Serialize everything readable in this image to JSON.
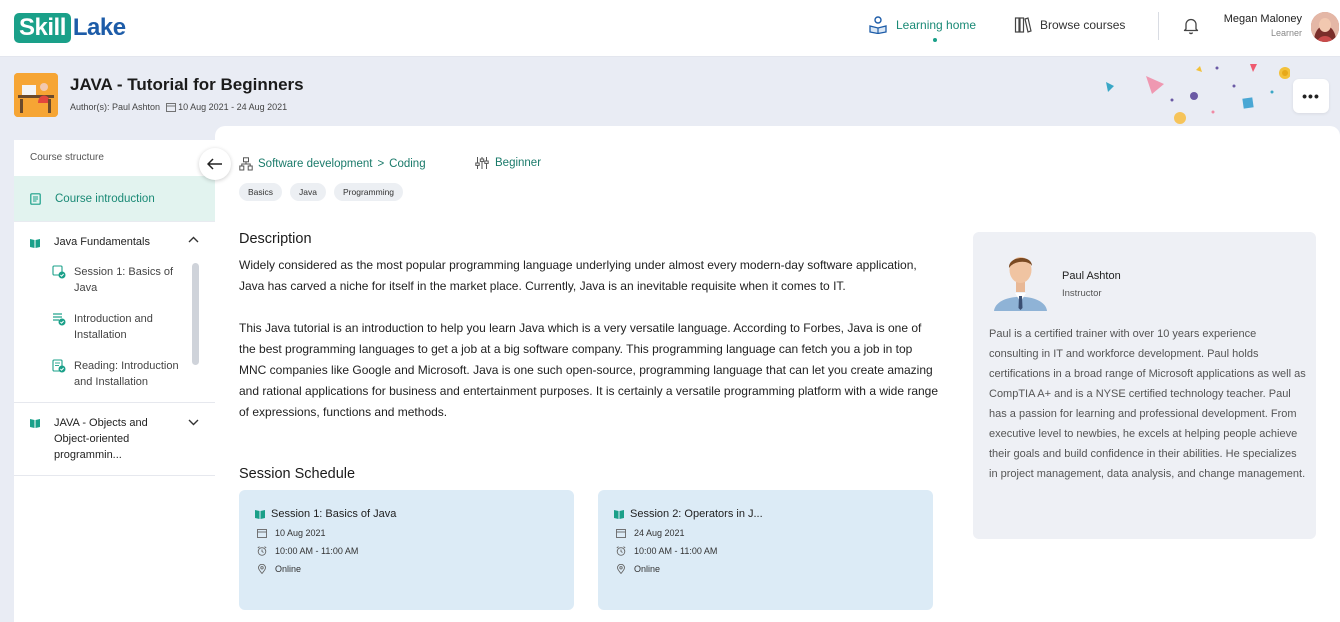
{
  "brand": {
    "logo_part1": "Skill",
    "logo_part2": "Lake",
    "primary_color": "#1aa089",
    "secondary_color": "#1d5ca8"
  },
  "nav": {
    "learning_home": "Learning home",
    "browse_courses": "Browse courses",
    "user_name": "Megan Maloney",
    "user_role": "Learner"
  },
  "course": {
    "title": "JAVA - Tutorial for Beginners",
    "authors": "Author(s): Paul Ashton",
    "dates": "10 Aug 2021 - 24 Aug 2021",
    "more_label": "•••"
  },
  "sidebar": {
    "heading": "Course structure",
    "intro": "Course introduction",
    "modules": [
      {
        "title": "Java Fundamentals",
        "sessions": [
          "Session 1: Basics of Java",
          "Introduction and Installation",
          "Reading: Introduction and Installation"
        ]
      },
      {
        "title": "JAVA - Objects and Object-oriented programmin..."
      }
    ]
  },
  "main": {
    "category": "Software development",
    "subcategory": "Coding",
    "level": "Beginner",
    "tags": [
      "Basics",
      "Java",
      "Programming"
    ],
    "description_heading": "Description",
    "description": [
      "Widely considered as the most popular programming language underlying under almost every modern-day software application, Java has carved a niche for itself in the market place. Currently, Java is an inevitable requisite when it comes to IT.",
      "This Java tutorial is an introduction to help you learn Java which is a very versatile language. According to Forbes, Java is one of the best programming languages to get a job at a big software company. This programming language can fetch you a job in top MNC companies like Google and Microsoft. Java is one such open-source, programming language that can let you create amazing and rational applications for business and entertainment purposes. It is certainly a versatile programming platform with a wide range of expressions, functions and methods."
    ],
    "schedule_heading": "Session Schedule",
    "sessions": [
      {
        "title": "Session 1: Basics of Java",
        "date": "10 Aug 2021",
        "time": "10:00 AM - 11:00 AM",
        "mode": "Online"
      },
      {
        "title": "Session 2: Operators in J...",
        "date": "24 Aug 2021",
        "time": "10:00 AM - 11:00 AM",
        "mode": "Online"
      }
    ]
  },
  "instructor": {
    "name": "Paul Ashton",
    "role": "Instructor",
    "bio": "Paul is a certified trainer with over 10 years experience consulting in IT and workforce development. Paul holds certifications in a broad range of Microsoft applications as well as CompTIA A+ and is a NYSE certified technology teacher. Paul has a passion for learning and professional development. From executive level to newbies, he excels at helping people achieve their goals and build confidence in their abilities. He specializes in project management, data analysis, and change management."
  }
}
